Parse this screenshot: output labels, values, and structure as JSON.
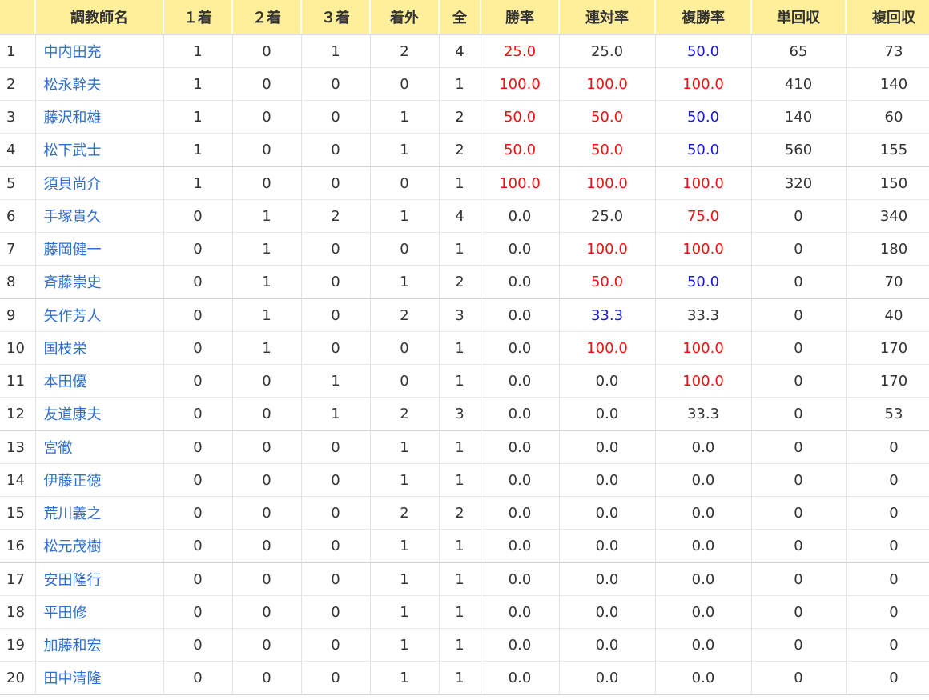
{
  "colors": {
    "header_bg": "#ffef9b",
    "link": "#2f6fd2",
    "highlight_red": "#ee1111",
    "highlight_blue": "#1a1ad9",
    "text": "#333333"
  },
  "table": {
    "headers": {
      "rank": "",
      "name": "調教師名",
      "first": "１着",
      "second": "２着",
      "third": "３着",
      "out": "着外",
      "total": "全",
      "win_rate": "勝率",
      "quinella_rate": "連対率",
      "show_rate": "複勝率",
      "win_return": "単回収",
      "show_return": "複回収"
    },
    "rows": [
      {
        "rank": "1",
        "name": "中内田充",
        "first": "1",
        "second": "0",
        "third": "1",
        "out": "2",
        "total": "4",
        "win_rate": "25.0",
        "win_rate_hl": "red",
        "quinella_rate": "25.0",
        "quinella_rate_hl": "plain",
        "show_rate": "50.0",
        "show_rate_hl": "blue",
        "win_return": "65",
        "show_return": "73"
      },
      {
        "rank": "2",
        "name": "松永幹夫",
        "first": "1",
        "second": "0",
        "third": "0",
        "out": "0",
        "total": "1",
        "win_rate": "100.0",
        "win_rate_hl": "red",
        "quinella_rate": "100.0",
        "quinella_rate_hl": "red",
        "show_rate": "100.0",
        "show_rate_hl": "red",
        "win_return": "410",
        "show_return": "140"
      },
      {
        "rank": "3",
        "name": "藤沢和雄",
        "first": "1",
        "second": "0",
        "third": "0",
        "out": "1",
        "total": "2",
        "win_rate": "50.0",
        "win_rate_hl": "red",
        "quinella_rate": "50.0",
        "quinella_rate_hl": "red",
        "show_rate": "50.0",
        "show_rate_hl": "blue",
        "win_return": "140",
        "show_return": "60"
      },
      {
        "rank": "4",
        "name": "松下武士",
        "first": "1",
        "second": "0",
        "third": "0",
        "out": "1",
        "total": "2",
        "win_rate": "50.0",
        "win_rate_hl": "red",
        "quinella_rate": "50.0",
        "quinella_rate_hl": "red",
        "show_rate": "50.0",
        "show_rate_hl": "blue",
        "win_return": "560",
        "show_return": "155"
      },
      {
        "rank": "5",
        "name": "須貝尚介",
        "first": "1",
        "second": "0",
        "third": "0",
        "out": "0",
        "total": "1",
        "win_rate": "100.0",
        "win_rate_hl": "red",
        "quinella_rate": "100.0",
        "quinella_rate_hl": "red",
        "show_rate": "100.0",
        "show_rate_hl": "red",
        "win_return": "320",
        "show_return": "150"
      },
      {
        "rank": "6",
        "name": "手塚貴久",
        "first": "0",
        "second": "1",
        "third": "2",
        "out": "1",
        "total": "4",
        "win_rate": "0.0",
        "win_rate_hl": "plain",
        "quinella_rate": "25.0",
        "quinella_rate_hl": "plain",
        "show_rate": "75.0",
        "show_rate_hl": "red",
        "win_return": "0",
        "show_return": "340"
      },
      {
        "rank": "7",
        "name": "藤岡健一",
        "first": "0",
        "second": "1",
        "third": "0",
        "out": "0",
        "total": "1",
        "win_rate": "0.0",
        "win_rate_hl": "plain",
        "quinella_rate": "100.0",
        "quinella_rate_hl": "red",
        "show_rate": "100.0",
        "show_rate_hl": "red",
        "win_return": "0",
        "show_return": "180"
      },
      {
        "rank": "8",
        "name": "斉藤崇史",
        "first": "0",
        "second": "1",
        "third": "0",
        "out": "1",
        "total": "2",
        "win_rate": "0.0",
        "win_rate_hl": "plain",
        "quinella_rate": "50.0",
        "quinella_rate_hl": "red",
        "show_rate": "50.0",
        "show_rate_hl": "blue",
        "win_return": "0",
        "show_return": "70"
      },
      {
        "rank": "9",
        "name": "矢作芳人",
        "first": "0",
        "second": "1",
        "third": "0",
        "out": "2",
        "total": "3",
        "win_rate": "0.0",
        "win_rate_hl": "plain",
        "quinella_rate": "33.3",
        "quinella_rate_hl": "blue",
        "show_rate": "33.3",
        "show_rate_hl": "plain",
        "win_return": "0",
        "show_return": "40"
      },
      {
        "rank": "10",
        "name": "国枝栄",
        "first": "0",
        "second": "1",
        "third": "0",
        "out": "0",
        "total": "1",
        "win_rate": "0.0",
        "win_rate_hl": "plain",
        "quinella_rate": "100.0",
        "quinella_rate_hl": "red",
        "show_rate": "100.0",
        "show_rate_hl": "red",
        "win_return": "0",
        "show_return": "170"
      },
      {
        "rank": "11",
        "name": "本田優",
        "first": "0",
        "second": "0",
        "third": "1",
        "out": "0",
        "total": "1",
        "win_rate": "0.0",
        "win_rate_hl": "plain",
        "quinella_rate": "0.0",
        "quinella_rate_hl": "plain",
        "show_rate": "100.0",
        "show_rate_hl": "red",
        "win_return": "0",
        "show_return": "170"
      },
      {
        "rank": "12",
        "name": "友道康夫",
        "first": "0",
        "second": "0",
        "third": "1",
        "out": "2",
        "total": "3",
        "win_rate": "0.0",
        "win_rate_hl": "plain",
        "quinella_rate": "0.0",
        "quinella_rate_hl": "plain",
        "show_rate": "33.3",
        "show_rate_hl": "plain",
        "win_return": "0",
        "show_return": "53"
      },
      {
        "rank": "13",
        "name": "宮徹",
        "first": "0",
        "second": "0",
        "third": "0",
        "out": "1",
        "total": "1",
        "win_rate": "0.0",
        "win_rate_hl": "plain",
        "quinella_rate": "0.0",
        "quinella_rate_hl": "plain",
        "show_rate": "0.0",
        "show_rate_hl": "plain",
        "win_return": "0",
        "show_return": "0"
      },
      {
        "rank": "14",
        "name": "伊藤正徳",
        "first": "0",
        "second": "0",
        "third": "0",
        "out": "1",
        "total": "1",
        "win_rate": "0.0",
        "win_rate_hl": "plain",
        "quinella_rate": "0.0",
        "quinella_rate_hl": "plain",
        "show_rate": "0.0",
        "show_rate_hl": "plain",
        "win_return": "0",
        "show_return": "0"
      },
      {
        "rank": "15",
        "name": "荒川義之",
        "first": "0",
        "second": "0",
        "third": "0",
        "out": "2",
        "total": "2",
        "win_rate": "0.0",
        "win_rate_hl": "plain",
        "quinella_rate": "0.0",
        "quinella_rate_hl": "plain",
        "show_rate": "0.0",
        "show_rate_hl": "plain",
        "win_return": "0",
        "show_return": "0"
      },
      {
        "rank": "16",
        "name": "松元茂樹",
        "first": "0",
        "second": "0",
        "third": "0",
        "out": "1",
        "total": "1",
        "win_rate": "0.0",
        "win_rate_hl": "plain",
        "quinella_rate": "0.0",
        "quinella_rate_hl": "plain",
        "show_rate": "0.0",
        "show_rate_hl": "plain",
        "win_return": "0",
        "show_return": "0"
      },
      {
        "rank": "17",
        "name": "安田隆行",
        "first": "0",
        "second": "0",
        "third": "0",
        "out": "1",
        "total": "1",
        "win_rate": "0.0",
        "win_rate_hl": "plain",
        "quinella_rate": "0.0",
        "quinella_rate_hl": "plain",
        "show_rate": "0.0",
        "show_rate_hl": "plain",
        "win_return": "0",
        "show_return": "0"
      },
      {
        "rank": "18",
        "name": "平田修",
        "first": "0",
        "second": "0",
        "third": "0",
        "out": "1",
        "total": "1",
        "win_rate": "0.0",
        "win_rate_hl": "plain",
        "quinella_rate": "0.0",
        "quinella_rate_hl": "plain",
        "show_rate": "0.0",
        "show_rate_hl": "plain",
        "win_return": "0",
        "show_return": "0"
      },
      {
        "rank": "19",
        "name": "加藤和宏",
        "first": "0",
        "second": "0",
        "third": "0",
        "out": "1",
        "total": "1",
        "win_rate": "0.0",
        "win_rate_hl": "plain",
        "quinella_rate": "0.0",
        "quinella_rate_hl": "plain",
        "show_rate": "0.0",
        "show_rate_hl": "plain",
        "win_return": "0",
        "show_return": "0"
      },
      {
        "rank": "20",
        "name": "田中清隆",
        "first": "0",
        "second": "0",
        "third": "0",
        "out": "1",
        "total": "1",
        "win_rate": "0.0",
        "win_rate_hl": "plain",
        "quinella_rate": "0.0",
        "quinella_rate_hl": "plain",
        "show_rate": "0.0",
        "show_rate_hl": "plain",
        "win_return": "0",
        "show_return": "0"
      }
    ]
  }
}
